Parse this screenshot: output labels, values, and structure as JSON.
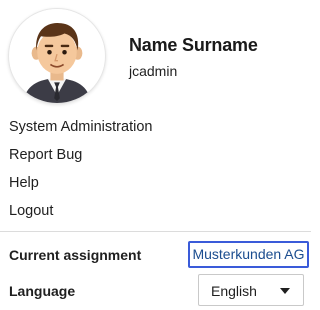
{
  "user": {
    "name": "Name Surname",
    "login": "jcadmin",
    "avatar_icon": "person-avatar-icon"
  },
  "menu": {
    "items": [
      {
        "label": "System Administration"
      },
      {
        "label": "Report Bug"
      },
      {
        "label": "Help"
      },
      {
        "label": "Logout"
      }
    ]
  },
  "assignment": {
    "label": "Current assignment",
    "value": "Musterkunden AG"
  },
  "language": {
    "label": "Language",
    "value": "English",
    "icon": "caret-down-icon"
  },
  "colors": {
    "link": "#1b4d8f",
    "focus_border": "#3a5bd9"
  }
}
